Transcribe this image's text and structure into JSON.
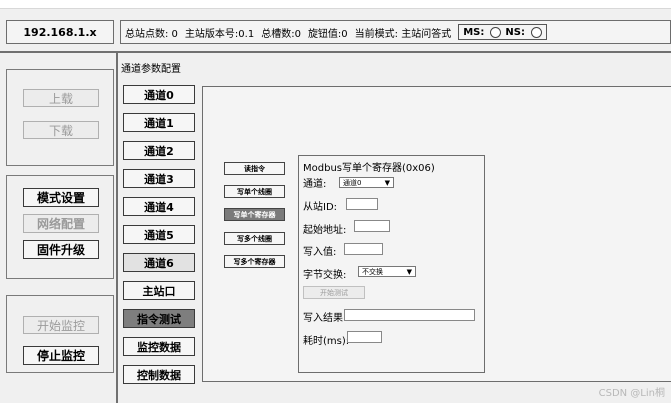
{
  "header": {
    "ip": "192.168.1.x",
    "status_items": [
      "总站点数: 0",
      "主站版本号:0.1",
      "总槽数:0",
      "旋钮值:0",
      "当前模式: 主站问答式"
    ],
    "ms_label": "MS:",
    "ns_label": "NS:"
  },
  "left": {
    "upload": "上载",
    "download": "下载",
    "mode_settings": "模式设置",
    "network_config": "网络配置",
    "firmware_upgrade": "固件升级",
    "start_monitor": "开始监控",
    "stop_monitor": "停止监控"
  },
  "nav": {
    "section_title": "通道参数配置",
    "channels": [
      "通道0",
      "通道1",
      "通道2",
      "通道3",
      "通道4",
      "通道5",
      "通道6"
    ],
    "master_port": "主站口",
    "cmd_test": "指令测试",
    "monitor_data": "监控数据",
    "control_data": "控制数据"
  },
  "commands": [
    "读指令",
    "写单个线圈",
    "写单个寄存器",
    "写多个线圈",
    "写多个寄存器"
  ],
  "panel": {
    "title": "Modbus写单个寄存器(0x06)",
    "channel_label": "通道:",
    "channel_value": "通道0",
    "slave_id_label": "从站ID:",
    "start_addr_label": "起始地址:",
    "write_value_label": "写入值:",
    "byte_swap_label": "字节交换:",
    "byte_swap_value": "不交换",
    "start_test": "开始测试",
    "write_result_label": "写入结果:",
    "elapsed_label": "耗时(ms):"
  },
  "watermark": "CSDN @Lin桐"
}
